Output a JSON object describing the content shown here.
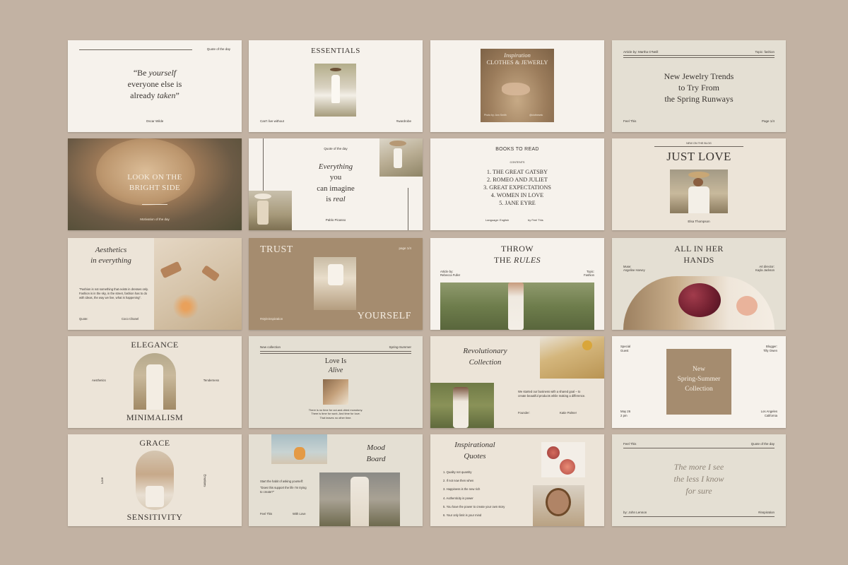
{
  "s1": {
    "header": "Quote of the day",
    "q1": "“Be ",
    "q1i": "yourself",
    "q2": "everyone else is",
    "q3": "already ",
    "q3i": "taken",
    "q3e": "”",
    "author": "Oscar Wilde"
  },
  "s2": {
    "title": "ESSENTIALS",
    "left": "Can't live without",
    "right": "#wardrobe"
  },
  "s3": {
    "l1": "Inspiration",
    "l2": "CLOTHES & JEWERLY",
    "fl": "Photo by: Ann Smith",
    "fr": "@clothesetc"
  },
  "s4": {
    "author": "Article by: Martha O'Neill",
    "topic": "Topic: fashion",
    "t1": "New Jewelry Trends",
    "t2": "to Try From",
    "t3": "the Spring Runways",
    "fl": "Feel This",
    "fr": "Page 1/4"
  },
  "s5": {
    "t1": "LOOK ON THE",
    "t2": "BRIGHT SIDE",
    "sub": "Motivation of the day"
  },
  "s6": {
    "header": "Quote of the day",
    "q1": "Everything",
    "q2": "you",
    "q3": "can imagine",
    "q4": "is ",
    "q4i": "real",
    "author": "Pablo Picasso"
  },
  "s7": {
    "title": "BOOKS TO READ",
    "contents": "CONTENTS",
    "items": [
      "1. THE GREAT GATSBY",
      "2. ROMEO AND JULIET",
      "3. GREAT EXPECTATIONS",
      "4. WOMEN IN LOVE",
      "5. JANE EYRE"
    ],
    "fl": "Language: English",
    "fr": "by Feel This"
  },
  "s8": {
    "top": "NEW ON THE BLOG",
    "title": "JUST LOVE",
    "name": "Elsa Thompson"
  },
  "s9": {
    "t1": "Aesthetics",
    "t2": "in everything",
    "body": "\"Fashion is not something that exists in dresses only. Fashion is in the sky, in the street, fashion has to do with ideas, the way we live, what is happening\".",
    "fl": "Quote:",
    "fr": "Coco Chanel"
  },
  "s10": {
    "t1": "TRUST",
    "page": "page 1/4",
    "tag": "#styleinspiration",
    "t2": "YOURSELF"
  },
  "s11": {
    "t1": "THROW",
    "t2": "THE ",
    "t2i": "RULES",
    "al": "Article by:",
    "an": "Rebecca Fuller",
    "tl": "Topic:",
    "tn": "Fashion"
  },
  "s12": {
    "t1": "ALL IN HER",
    "t2": "HANDS",
    "ml": "Muse:",
    "mn": "Angeline Harvey",
    "dl": "Art director:",
    "dn": "Kayla Jackson"
  },
  "s13": {
    "t1": "ELEGANCE",
    "left": "Aesthetics",
    "right": "Tenderness",
    "t2": "MINIMALISM"
  },
  "s14": {
    "left": "New collection",
    "right": "Spring-Summer",
    "t1": "Love Is",
    "t2": "Alive",
    "b1": "There is no time for cut-and-dried monotony.",
    "b2": "There is time for work. And time for love.",
    "b3": "That leaves no other time."
  },
  "s15": {
    "t1": "Revolutionary",
    "t2": "Collection",
    "body": "We started our business with a shared goal – to create beautiful products while making a difference.",
    "fl": "Founder:",
    "fr": "Katie Palmer"
  },
  "s16": {
    "sg1": "Special",
    "sg2": "Guest",
    "bl1": "Blogger:",
    "bl2": "Tilly Owen",
    "b1": "New",
    "b2": "Spring-Summer",
    "b3": "Collection",
    "d1": "May 26",
    "d2": "2 pm",
    "l1": "Los Angeles",
    "l2": "California"
  },
  "s17": {
    "t1": "GRACE",
    "left": "Love",
    "right": "Emotions",
    "t2": "SENSITIVITY"
  },
  "s18": {
    "t1": "Mood",
    "t2": "Board",
    "b1": "Start the habit of asking yourself:",
    "b2": "\"Does this support the life I'm trying to create?\"",
    "fl": "Feel This",
    "fr": "With Love"
  },
  "s19": {
    "t1": "Inspirational",
    "t2": "Quotes",
    "items": [
      "1. Quality not quantity",
      "2. If not now then when",
      "3. Happiness is the new rich",
      "4. Authenticity is power",
      "5. You have the power to create your own story",
      "6. Your only limit is your mind"
    ]
  },
  "s20": {
    "hl": "Feel This",
    "hr": "Quote of the day",
    "q1": "The more I see",
    "q2": "the less I know",
    "q3": "for sure",
    "by": "by: John Lennon",
    "tag": "#inspiration"
  }
}
